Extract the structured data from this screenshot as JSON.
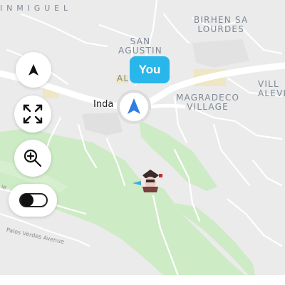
{
  "map": {
    "area_labels": {
      "top_left_partial": "I N  M I G U E L",
      "birhen_line1": "BIRHEN SA",
      "birhen_line2": "LOURDES",
      "san_line1": "SAN",
      "san_line2": "AGUSTIN",
      "magradeco_line1": "MAGRADECO",
      "magradeco_line2": "VILLAGE",
      "ville_line1": "VILL",
      "ville_line2": "ALEVI",
      "al_partial": "AL"
    },
    "place_label": "Inda",
    "street_labels": {
      "palos_verdes": "Palos Verdes Avenue",
      "left_partial": "ie"
    }
  },
  "user_marker": {
    "badge_text": "You"
  },
  "controls": {
    "recenter_icon": "navigation-arrow-icon",
    "fullscreen_icon": "expand-arrows-icon",
    "zoom_icon": "zoom-in-icon",
    "toggle_state": "off"
  },
  "colors": {
    "badge": "#29b6ea",
    "location_arrow": "#2f7de1",
    "park_green": "#cdebc4",
    "map_background": "#ececec"
  }
}
